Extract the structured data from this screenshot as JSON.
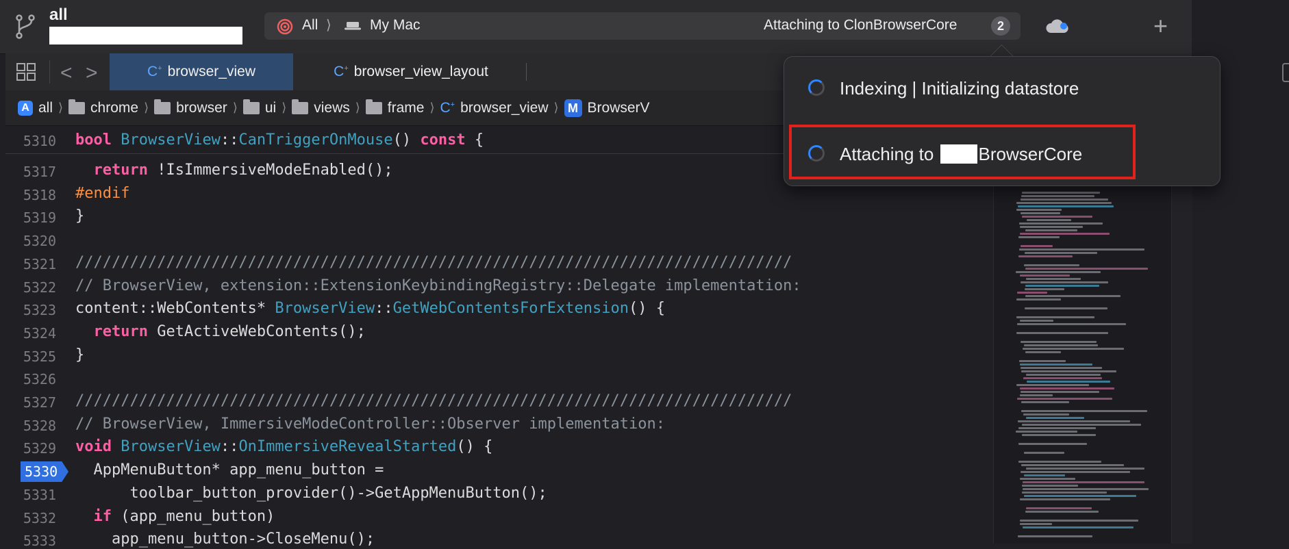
{
  "toolbar": {
    "project": "all",
    "scheme": "All",
    "destination": "My Mac",
    "status": "Attaching to ClonBrowserCore",
    "status_count": "2"
  },
  "tabs": [
    {
      "label": "browser_view",
      "active": true
    },
    {
      "label": "browser_view_layout",
      "active": false
    }
  ],
  "breadcrumb": [
    "all",
    "chrome",
    "browser",
    "ui",
    "views",
    "frame",
    "browser_view",
    "BrowserV"
  ],
  "popover": {
    "task1": "Indexing | Initializing datastore",
    "task2_prefix": "Attaching to",
    "task2_suffix": "BrowserCore"
  },
  "code": {
    "sticky": {
      "ln": "5310",
      "kw1": "bool",
      "cls": "BrowserView",
      "sep": "::",
      "fn": "CanTriggerOnMouse",
      "rest": "() ",
      "kw2": "const",
      "end": " {"
    },
    "lines": [
      {
        "ln": "5317"
      },
      {
        "ln": "5318",
        "pp": "#endif"
      },
      {
        "ln": "5319",
        "text": "}"
      },
      {
        "ln": "5320"
      },
      {
        "ln": "5321",
        "cm": "///////////////////////////////////////////////////////////////////////////////"
      },
      {
        "ln": "5322",
        "cm": "// BrowserView, extension::ExtensionKeybindingRegistry::Delegate implementation:"
      },
      {
        "ln": "5323"
      },
      {
        "ln": "5324"
      },
      {
        "ln": "5325",
        "text": "}"
      },
      {
        "ln": "5326"
      },
      {
        "ln": "5327",
        "cm": "///////////////////////////////////////////////////////////////////////////////"
      },
      {
        "ln": "5328",
        "cm": "// BrowserView, ImmersiveModeController::Observer implementation:"
      },
      {
        "ln": "5329"
      },
      {
        "ln": "5330"
      },
      {
        "ln": "5331",
        "text": "      toolbar_button_provider()->GetAppMenuButton();"
      },
      {
        "ln": "5332"
      },
      {
        "ln": "5333",
        "text": "    app_menu_button->CloseMenu();"
      }
    ],
    "l5317": {
      "kw": "return",
      "rest": " !IsImmersiveModeEnabled();"
    },
    "l5323": {
      "pre": "content::WebContents* ",
      "cls": "BrowserView",
      "sep": "::",
      "fn": "GetWebContentsForExtension",
      "end": "() {"
    },
    "l5324": {
      "kw": "return",
      "rest": " GetActiveWebContents();"
    },
    "l5329": {
      "kw": "void",
      "cls": "BrowserView",
      "sep": "::",
      "fn": "OnImmersiveRevealStarted",
      "end": "() {"
    },
    "l5330": {
      "text": "  AppMenuButton* app_menu_button ="
    },
    "l5332": {
      "kw": "if",
      "rest": " (app_menu_button)"
    }
  }
}
